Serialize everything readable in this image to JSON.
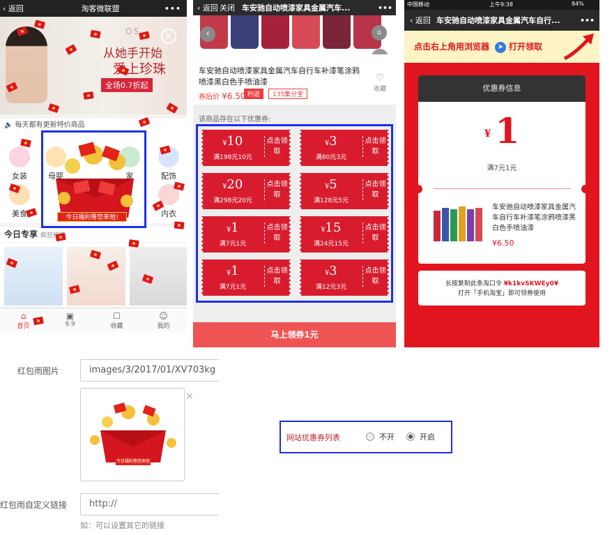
{
  "panel1": {
    "back_label": "返回",
    "title": "淘客微联盟",
    "more": "•••",
    "banner_brand": "OS",
    "banner_line1": "从她手开始",
    "banner_line2": "爱上珍珠",
    "banner_sale": "全场0.7折起",
    "notice": "每天都有更新特价商品",
    "categories": [
      "女装",
      "母婴",
      "",
      "家",
      "配饰",
      "美食",
      "",
      "",
      "",
      "内衣"
    ],
    "today_title": "今日专享",
    "today_sub": "疯狂抢购",
    "redpacket_caption": "今日福利等您来抢!",
    "tabs": [
      "首页",
      "9.9",
      "收藏",
      "我的"
    ]
  },
  "panel2": {
    "back_label": "返回",
    "close_label": "关闭",
    "title": "车安驰自动喷漆家具金属汽车...",
    "more": "•••",
    "product_title": "车安驰自动喷漆家具金属汽车自行车补漆笔涂鸦喷漆黑白色手喷油漆",
    "price_prefix": "券后价",
    "price": "¥6.50",
    "tag_a": "约返",
    "tag_b": "135集分宝",
    "fav_label": "收藏",
    "coupon_intro": "该商品存在以下优惠券:",
    "coupon_action": "点击领取",
    "coupons": [
      {
        "amount": "10",
        "cond": "满198元10元"
      },
      {
        "amount": "3",
        "cond": "满80元3元"
      },
      {
        "amount": "20",
        "cond": "满298元20元"
      },
      {
        "amount": "5",
        "cond": "满128元5元"
      },
      {
        "amount": "1",
        "cond": "满7元1元"
      },
      {
        "amount": "15",
        "cond": "满24元15元"
      },
      {
        "amount": "1",
        "cond": "满7元1元"
      },
      {
        "amount": "3",
        "cond": "满12元3元"
      }
    ],
    "button": "马上领券1元"
  },
  "panel3": {
    "status_carrier": "中国移动",
    "status_time": "上午9:38",
    "status_battery": "84%",
    "back_label": "返回",
    "title": "车安驰自动喷漆家具金属汽车自行...",
    "more": "•••",
    "tip_left": "点击右上角用浏览器",
    "tip_right": "打开领取",
    "card_title": "优惠券信息",
    "yen": "¥",
    "amount": "1",
    "cond": "满7元1元",
    "product_title": "车安驰自动喷漆家具金属汽车自行车补漆笔涂鸦喷漆黑白色手喷油漆",
    "product_price": "¥6.50",
    "copy_line1_prefix": "长按复制此条淘口令",
    "copy_code": "¥k1kvSKWEy0¥",
    "copy_line2": "打开「手机淘宝」即可领券使用"
  },
  "form": {
    "redrain_label": "红包雨图片",
    "redrain_path": "images/3/2017/01/XV703kg",
    "redrain_preview_caption": "今日福利等您来抢",
    "remove_icon": "×",
    "link_label": "红包雨自定义链接",
    "link_placeholder": "http://",
    "link_hint": "如：可以设置其它的链接",
    "coupon_list_label": "网站优惠券列表",
    "option_off": "不开",
    "option_on": "开启",
    "selected": "开启"
  },
  "colors": {
    "accent_red": "#e0151e",
    "highlight_blue": "#1a2fe8",
    "coupon_red": "#d81c2e"
  }
}
